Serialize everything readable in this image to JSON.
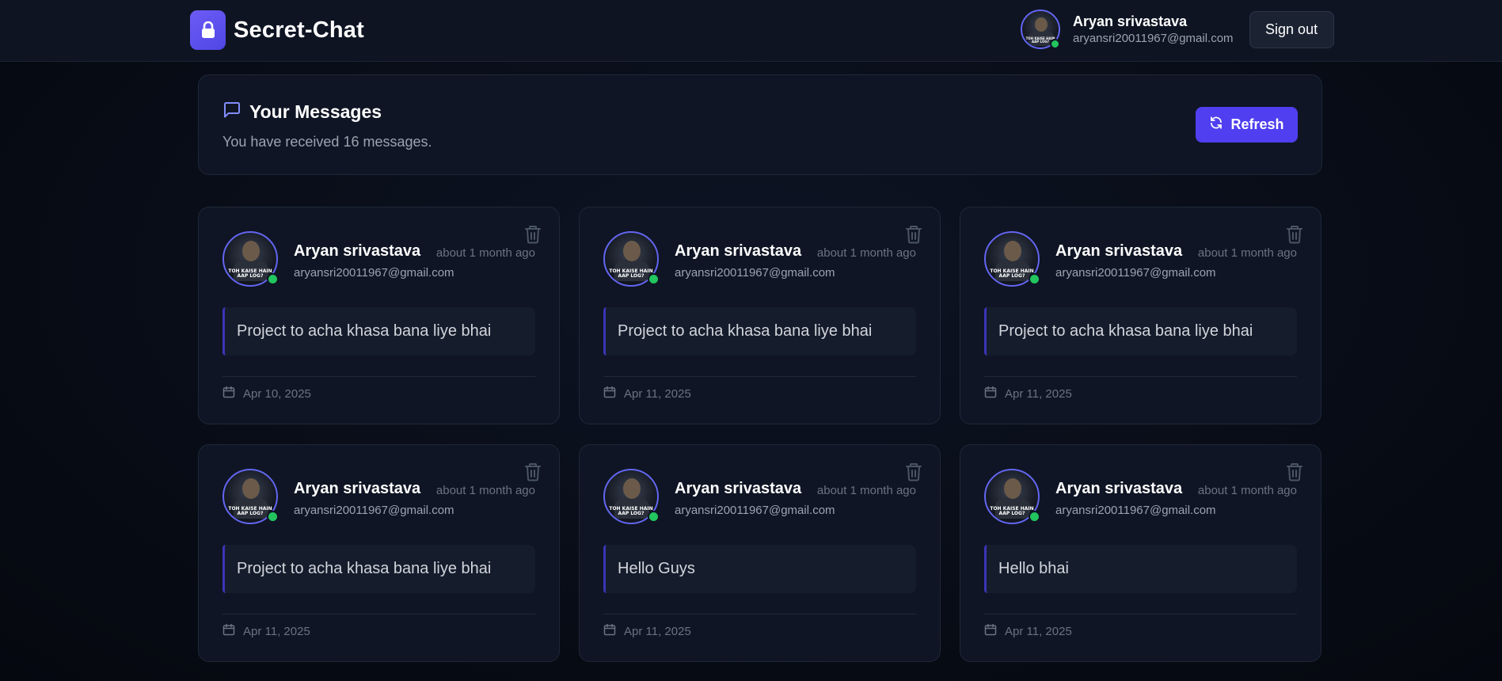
{
  "app": {
    "name": "Secret-Chat"
  },
  "user": {
    "name": "Aryan srivastava",
    "email": "aryansri20011967@gmail.com",
    "avatar_caption": "TOH KAISE HAIN AAP LOG?"
  },
  "signout_label": "Sign out",
  "messages_header": {
    "title": "Your Messages",
    "subtitle": "You have received 16 messages.",
    "refresh_label": "Refresh"
  },
  "colors": {
    "accent": "#4f3ff0",
    "online": "#22c55e",
    "background": "#070b14",
    "card": "#0f1524"
  },
  "messages": [
    {
      "sender": "Aryan srivastava",
      "email": "aryansri20011967@gmail.com",
      "time_ago": "about 1 month ago",
      "content": "Project to acha khasa bana liye bhai",
      "date": "Apr 10, 2025"
    },
    {
      "sender": "Aryan srivastava",
      "email": "aryansri20011967@gmail.com",
      "time_ago": "about 1 month ago",
      "content": "Project to acha khasa bana liye bhai",
      "date": "Apr 11, 2025"
    },
    {
      "sender": "Aryan srivastava",
      "email": "aryansri20011967@gmail.com",
      "time_ago": "about 1 month ago",
      "content": "Project to acha khasa bana liye bhai",
      "date": "Apr 11, 2025"
    },
    {
      "sender": "Aryan srivastava",
      "email": "aryansri20011967@gmail.com",
      "time_ago": "about 1 month ago",
      "content": "Project to acha khasa bana liye bhai",
      "date": "Apr 11, 2025"
    },
    {
      "sender": "Aryan srivastava",
      "email": "aryansri20011967@gmail.com",
      "time_ago": "about 1 month ago",
      "content": "Hello Guys",
      "date": "Apr 11, 2025"
    },
    {
      "sender": "Aryan srivastava",
      "email": "aryansri20011967@gmail.com",
      "time_ago": "about 1 month ago",
      "content": "Hello bhai",
      "date": "Apr 11, 2025"
    }
  ]
}
